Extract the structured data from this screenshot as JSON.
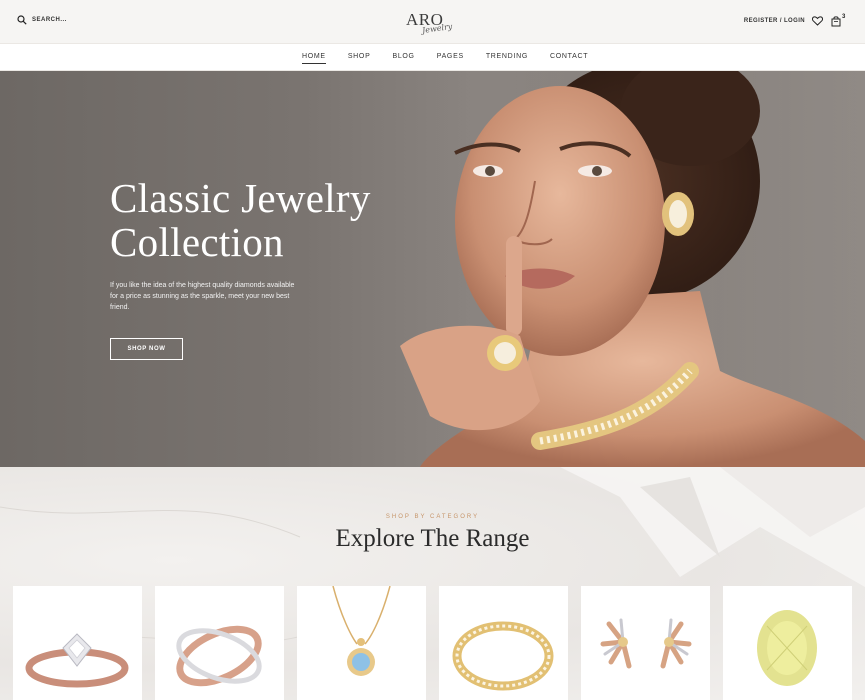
{
  "header": {
    "search_label": "SEARCH...",
    "logo_main": "ARO",
    "logo_script": "Jewelry",
    "account_label": "REGISTER / LOGIN",
    "cart_count": "3",
    "icons": [
      "search-icon",
      "heart-icon",
      "cart-icon"
    ]
  },
  "nav": {
    "items": [
      {
        "label": "HOME",
        "active": true
      },
      {
        "label": "SHOP",
        "active": false
      },
      {
        "label": "BLOG",
        "active": false
      },
      {
        "label": "PAGES",
        "active": false
      },
      {
        "label": "TRENDING",
        "active": false
      },
      {
        "label": "CONTACT",
        "active": false
      }
    ]
  },
  "hero": {
    "title_line1": "Classic Jewelry",
    "title_line2": "Collection",
    "description": "If you like the idea of the highest quality diamonds available for a price as stunning as the sparkle, meet your new best friend.",
    "button_label": "SHOP NOW"
  },
  "category": {
    "eyebrow": "SHOP BY CATEGORY",
    "title": "Explore The Range",
    "cards": [
      {
        "name": "diamond-ring"
      },
      {
        "name": "crossover-ring"
      },
      {
        "name": "pendant-necklace"
      },
      {
        "name": "tennis-bracelet"
      },
      {
        "name": "flower-earrings"
      },
      {
        "name": "yellow-gemstone"
      }
    ]
  },
  "colors": {
    "accent": "#c6956a",
    "header_bg": "#f6f5f3",
    "hero_bg": "#7a7470"
  }
}
